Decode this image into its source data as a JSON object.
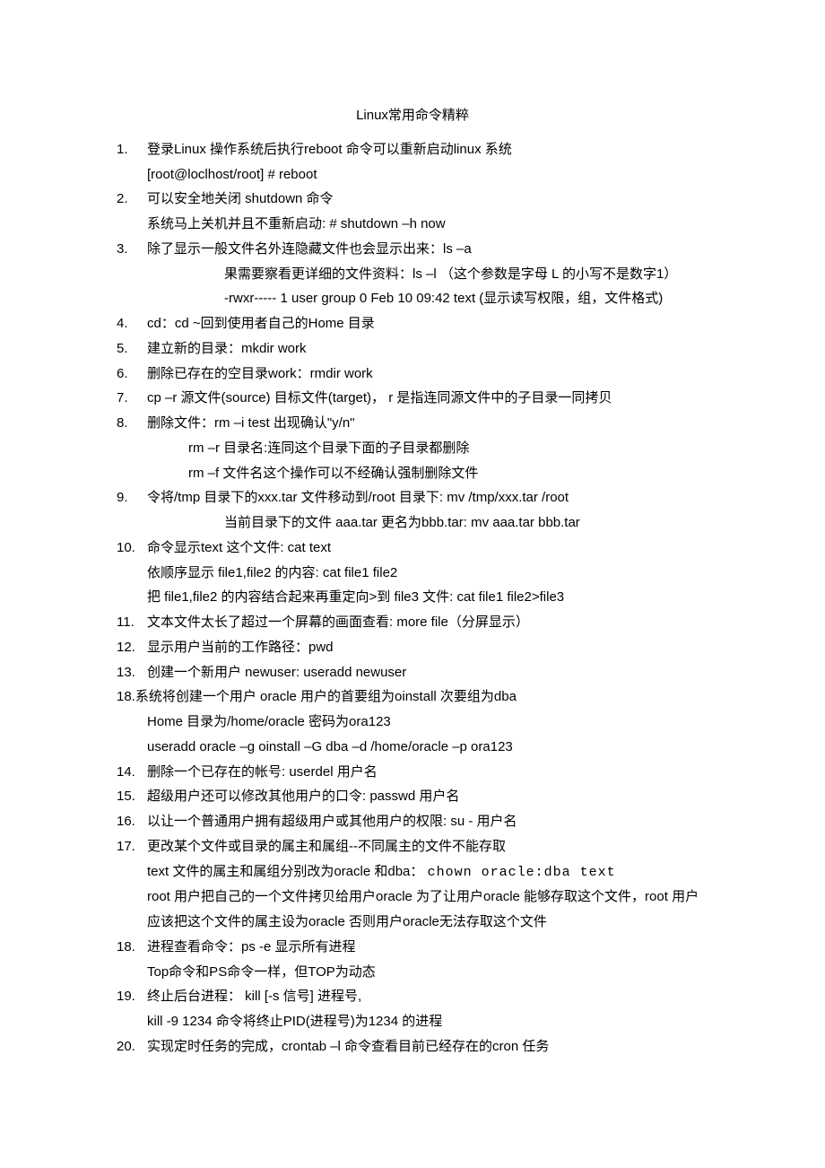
{
  "title": "Linux常用命令精粹",
  "items": [
    {
      "n": "1.",
      "lines": [
        "登录Linux 操作系统后执行reboot 命令可以重新启动linux 系统",
        "[root@loclhost/root] # reboot"
      ]
    },
    {
      "n": "2.",
      "lines": [
        "可以安全地关闭 shutdown 命令",
        "系统马上关机并且不重新启动: # shutdown –h now"
      ]
    },
    {
      "n": "3.",
      "lines": [
        "除了显示一般文件名外连隐藏文件也会显示出来：ls –a"
      ],
      "sub": [
        "果需要察看更详细的文件资料：ls –l （这个参数是字母 L 的小写不是数字1）",
        "-rwxr----- 1 user group 0 Feb 10 09:42 text (显示读写权限，组，文件格式)"
      ]
    },
    {
      "n": "4.",
      "lines": [
        "cd：cd ~回到使用者自己的Home 目录"
      ]
    },
    {
      "n": "5.",
      "lines": [
        "建立新的目录：mkdir work"
      ]
    },
    {
      "n": "6.",
      "lines": [
        "删除已存在的空目录work：rmdir work"
      ]
    },
    {
      "n": "7.",
      "lines": [
        "cp –r 源文件(source) 目标文件(target)， r 是指连同源文件中的子目录一同拷贝"
      ]
    },
    {
      "n": "8.",
      "lines": [
        "删除文件：rm –i   test 出现确认\"y/n\""
      ],
      "sub3": [
        "rm –r 目录名:连同这个目录下面的子目录都删除",
        "rm –f 文件名这个操作可以不经确认强制删除文件"
      ]
    },
    {
      "n": "9.",
      "lines": [
        "令将/tmp 目录下的xxx.tar 文件移动到/root 目录下: mv /tmp/xxx.tar   /root"
      ],
      "sub": [
        "当前目录下的文件 aaa.tar 更名为bbb.tar:   mv aaa.tar bbb.tar"
      ]
    },
    {
      "n": "10.",
      "lines": [
        "命令显示text 这个文件: cat text",
        "依顺序显示 file1,file2 的内容: cat file1 file2",
        "把 file1,file2 的内容结合起来再重定向>到 file3 文件: cat file1 file2>file3"
      ]
    },
    {
      "n": "11.",
      "lines": [
        "文本文件太长了超过一个屏幕的画面查看: more file（分屏显示）"
      ]
    },
    {
      "n": "12.",
      "lines": [
        "显示用户当前的工作路径：pwd"
      ]
    },
    {
      "n": "13.",
      "lines": [
        "创建一个新用户 newuser:   useradd newuser"
      ]
    },
    {
      "n": "18.",
      "noffset": true,
      "lines": [
        "系统将创建一个用户 oracle 用户的首要组为oinstall 次要组为dba",
        "Home 目录为/home/oracle 密码为ora123",
        "useradd oracle –g oinstall –G dba –d /home/oracle –p ora123"
      ]
    },
    {
      "n": "14.",
      "lines": [
        "删除一个已存在的帐号: userdel 用户名"
      ]
    },
    {
      "n": "15.",
      "lines": [
        "超级用户还可以修改其他用户的口令: passwd 用户名"
      ]
    },
    {
      "n": "16.",
      "lines": [
        "以让一个普通用户拥有超级用户或其他用户的权限: su - 用户名"
      ]
    },
    {
      "n": "17.",
      "lines": [
        "更改某个文件或目录的属主和属组--不同属主的文件不能存取"
      ],
      "body": [
        "text 文件的属主和属组分别改为oracle 和dba：  <span class=\"mono\">chown oracle:dba text</span>",
        "root 用户把自己的一个文件拷贝给用户oracle 为了让用户oracle 能够存取这个文件，root 用户应该把这个文件的属主设为oracle 否则用户oracle无法存取这个文件"
      ]
    },
    {
      "n": "18.",
      "lines": [
        "进程查看命令：ps   -e 显示所有进程",
        "Top命令和PS命令一样，但TOP为动态"
      ]
    },
    {
      "n": "19.",
      "lines": [
        "终止后台进程： kill [-s 信号] 进程号,",
        "kill -9 1234 命令将终止PID(进程号)为1234 的进程"
      ]
    },
    {
      "n": "20.",
      "lines": [
        "实现定时任务的完成，crontab –l 命令查看目前已经存在的cron 任务"
      ]
    }
  ]
}
